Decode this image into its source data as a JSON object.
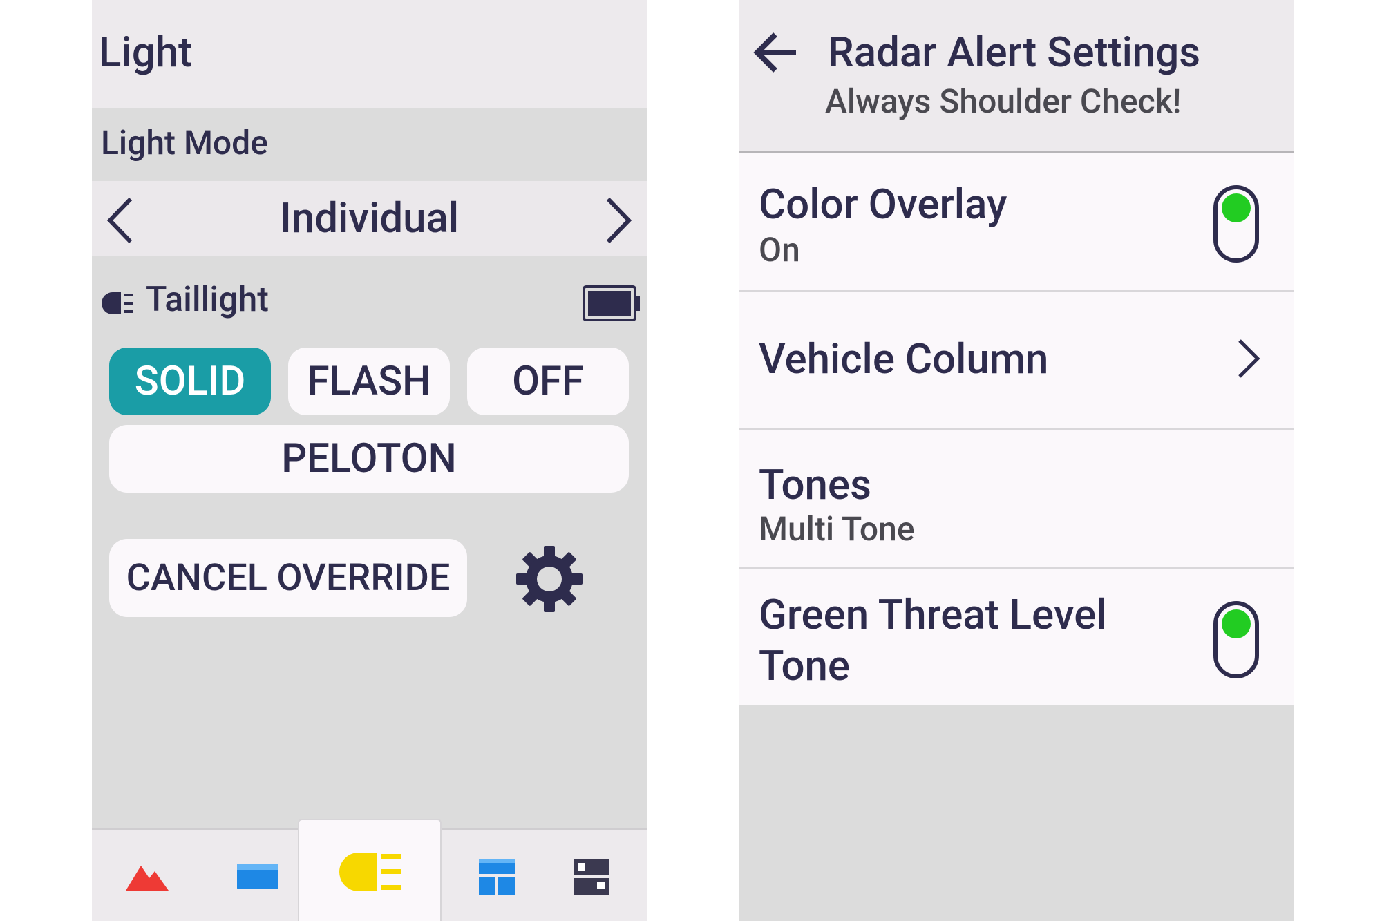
{
  "left": {
    "title": "Light",
    "section_label": "Light Mode",
    "mode_value": "Individual",
    "light_name": "Taillight",
    "buttons": {
      "solid": "SOLID",
      "flash": "FLASH",
      "off": "OFF",
      "peloton": "PELOTON",
      "cancel": "CANCEL OVERRIDE"
    },
    "active_mode": "SOLID",
    "icons": [
      "mountain-icon",
      "card-icon",
      "light-icon",
      "dashboard-icon",
      "device-icon",
      "gear-icon",
      "battery-icon"
    ],
    "colors": {
      "accent": "#1a9da6",
      "text": "#2e2c4d"
    }
  },
  "right": {
    "title": "Radar Alert Settings",
    "subtitle": "Always Shoulder Check!",
    "items": [
      {
        "title": "Color Overlay",
        "subtitle": "On",
        "toggle": true
      },
      {
        "title": "Vehicle Column"
      },
      {
        "title": "Tones",
        "subtitle": "Multi Tone"
      },
      {
        "title_line1": "Green Threat Level",
        "title_line2": "Tone",
        "toggle": true
      }
    ],
    "colors": {
      "toggle_on": "#22cc22"
    }
  }
}
